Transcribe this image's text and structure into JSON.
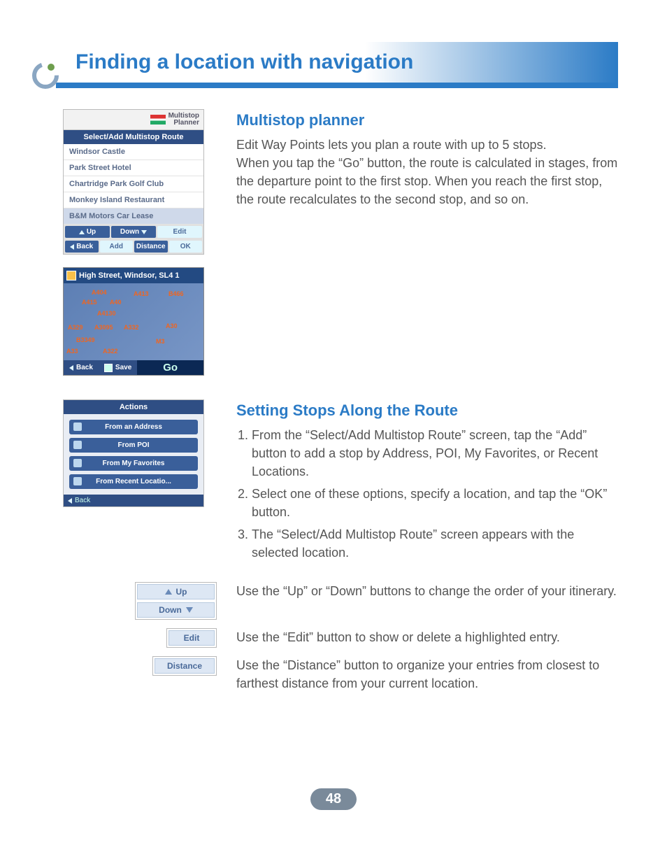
{
  "page": {
    "title": "Finding a location with navigation",
    "number": "48"
  },
  "multistop": {
    "heading": "Multistop planner",
    "body": "Edit Way Points lets you plan a route with up to 5 stops.\nWhen you tap the “Go” button, the route is calculated in stages, from the departure point to the first stop. When you reach the first stop, the route recalculates to the second stop, and so on.",
    "screen_header": "Multistop\nPlanner",
    "list_title": "Select/Add Multistop Route",
    "items": [
      "Windsor Castle",
      "Park Street Hotel",
      "Chartridge Park Golf Club",
      "Monkey Island Restaurant",
      "B&M Motors Car Lease"
    ],
    "buttons": {
      "up": "Up",
      "down": "Down",
      "edit": "Edit",
      "back": "Back",
      "add": "Add",
      "distance": "Distance",
      "ok": "OK"
    }
  },
  "map": {
    "title": "High Street, Windsor, SL4 1",
    "roads": [
      "A404",
      "A413",
      "A415",
      "A40",
      "A4130",
      "A329",
      "A3095",
      "A332",
      "B3349",
      "A33",
      "A322",
      "M3",
      "A30",
      "B466"
    ],
    "foot": {
      "back": "Back",
      "save": "Save",
      "go": "Go"
    }
  },
  "stops": {
    "heading": "Setting Stops Along the Route",
    "steps": [
      "From the “Select/Add Multistop Route” screen, tap the “Add” button to add a stop by Address, POI, My Favorites, or Recent Locations.",
      "Select one of these options, specify a location, and tap the “OK” button.",
      "The “Select/Add Multistop Route” screen appears with the selected location."
    ],
    "actions_title": "Actions",
    "actions": [
      "From an Address",
      "From POI",
      "From My Favorites",
      "From Recent Locatio..."
    ],
    "actions_back": "Back"
  },
  "insets": {
    "up": "Up",
    "down": "Down",
    "edit": "Edit",
    "distance": "Distance",
    "up_text": "Use the “Up” or “Down” buttons to change the order of your itinerary.",
    "edit_text": "Use the “Edit” button to show or delete a highlighted entry.",
    "distance_text": "Use the “Distance” button to organize your entries from closest to farthest distance from your current location."
  }
}
